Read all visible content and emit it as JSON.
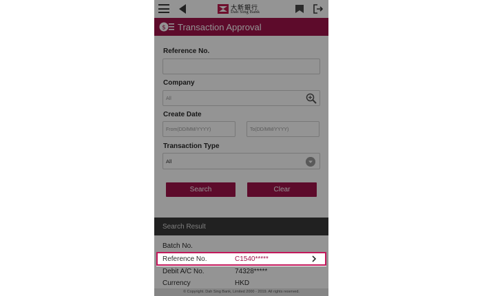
{
  "brand": {
    "name_cn": "大新銀行",
    "name_en": "Dah Sing Bank"
  },
  "page": {
    "title": "Transaction Approval"
  },
  "form": {
    "reference_label": "Reference No.",
    "reference_value": "",
    "company_label": "Company",
    "company_value": "All",
    "create_date_label": "Create Date",
    "from_placeholder": "From(DD/MM/YYYY)",
    "to_placeholder": "To(DD/MM/YYYY)",
    "transaction_type_label": "Transaction Type",
    "transaction_type_value": "All",
    "search_label": "Search",
    "clear_label": "Clear"
  },
  "results": {
    "header": "Search Result",
    "rows": [
      {
        "key": "Batch No.",
        "value": ""
      },
      {
        "key": "Reference No.",
        "value": "C1540*****"
      },
      {
        "key": "Debit A/C No.",
        "value": "74328*****"
      },
      {
        "key": "Currency",
        "value": "HKD"
      }
    ]
  },
  "footer": {
    "copyright": "© Copyright. Dah Sing Bank, Limited 2000 - 2019. All rights reserved."
  },
  "colors": {
    "accent": "#a0134b",
    "highlight_border": "#c2185b",
    "dark_header": "#3a3a3a"
  },
  "icons": [
    "menu-icon",
    "back-arrow-icon",
    "bank-logo",
    "flag-icon",
    "logout-icon",
    "transaction-approval-icon",
    "search-zoom-icon",
    "dropdown-caret-icon",
    "chevron-right-icon"
  ]
}
